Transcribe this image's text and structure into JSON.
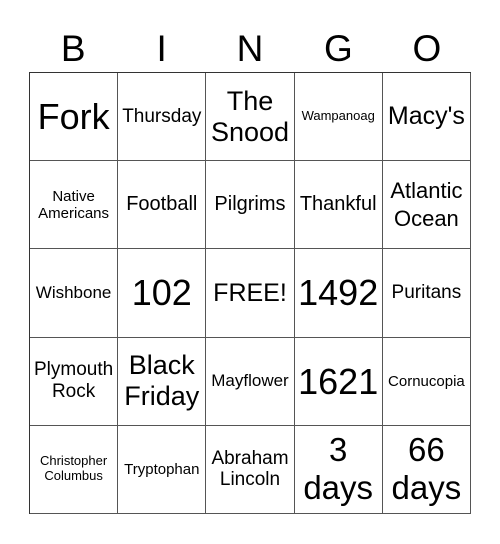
{
  "header": [
    "B",
    "I",
    "N",
    "G",
    "O"
  ],
  "cells": [
    [
      "Fork",
      "Thursday",
      "The Snood",
      "Wampanoag",
      "Macy's"
    ],
    [
      "Native Americans",
      "Football",
      "Pilgrims",
      "Thankful",
      "Atlantic Ocean"
    ],
    [
      "Wishbone",
      "102",
      "FREE!",
      "1492",
      "Puritans"
    ],
    [
      "Plymouth Rock",
      "Black Friday",
      "Mayflower",
      "1621",
      "Cornucopia"
    ],
    [
      "Christopher Columbus",
      "Tryptophan",
      "Abraham Lincoln",
      "3 days",
      "66 days"
    ]
  ]
}
